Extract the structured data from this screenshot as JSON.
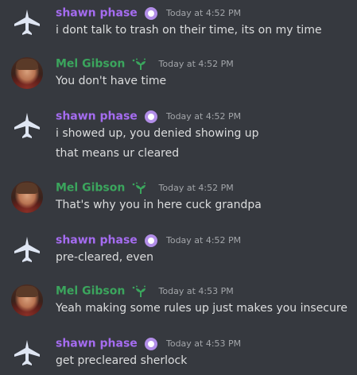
{
  "messages": [
    {
      "author": "shawn phase",
      "time": "Today at 4:52 PM",
      "lines": [
        "i dont talk to trash on their time, its on my time"
      ]
    },
    {
      "author": "Mel Gibson",
      "time": "Today at 4:52 PM",
      "lines": [
        "You don't have time"
      ]
    },
    {
      "author": "shawn phase",
      "time": "Today at 4:52 PM",
      "lines": [
        "i showed up, you denied showing up",
        "that means ur cleared"
      ]
    },
    {
      "author": "Mel Gibson",
      "time": "Today at 4:52 PM",
      "lines": [
        "That's why you in here cuck grandpa"
      ]
    },
    {
      "author": "shawn phase",
      "time": "Today at 4:52 PM",
      "lines": [
        "pre-cleared, even"
      ]
    },
    {
      "author": "Mel Gibson",
      "time": "Today at 4:53 PM",
      "lines": [
        "Yeah making some rules up just makes you insecure"
      ]
    },
    {
      "author": "shawn phase",
      "time": "Today at 4:53 PM",
      "lines": [
        "get precleared sherlock"
      ]
    }
  ],
  "colors": {
    "background": "#36393f",
    "shawn_name": "#a56cf0",
    "mel_name": "#3ba55d",
    "message_text": "#dcddde",
    "timestamp": "#a3a6aa"
  },
  "icons": {
    "shawn_avatar": "jet-icon",
    "shawn_badge": "dog-icon",
    "mel_avatar": "avatar",
    "mel_badge": "sprout-icon"
  }
}
